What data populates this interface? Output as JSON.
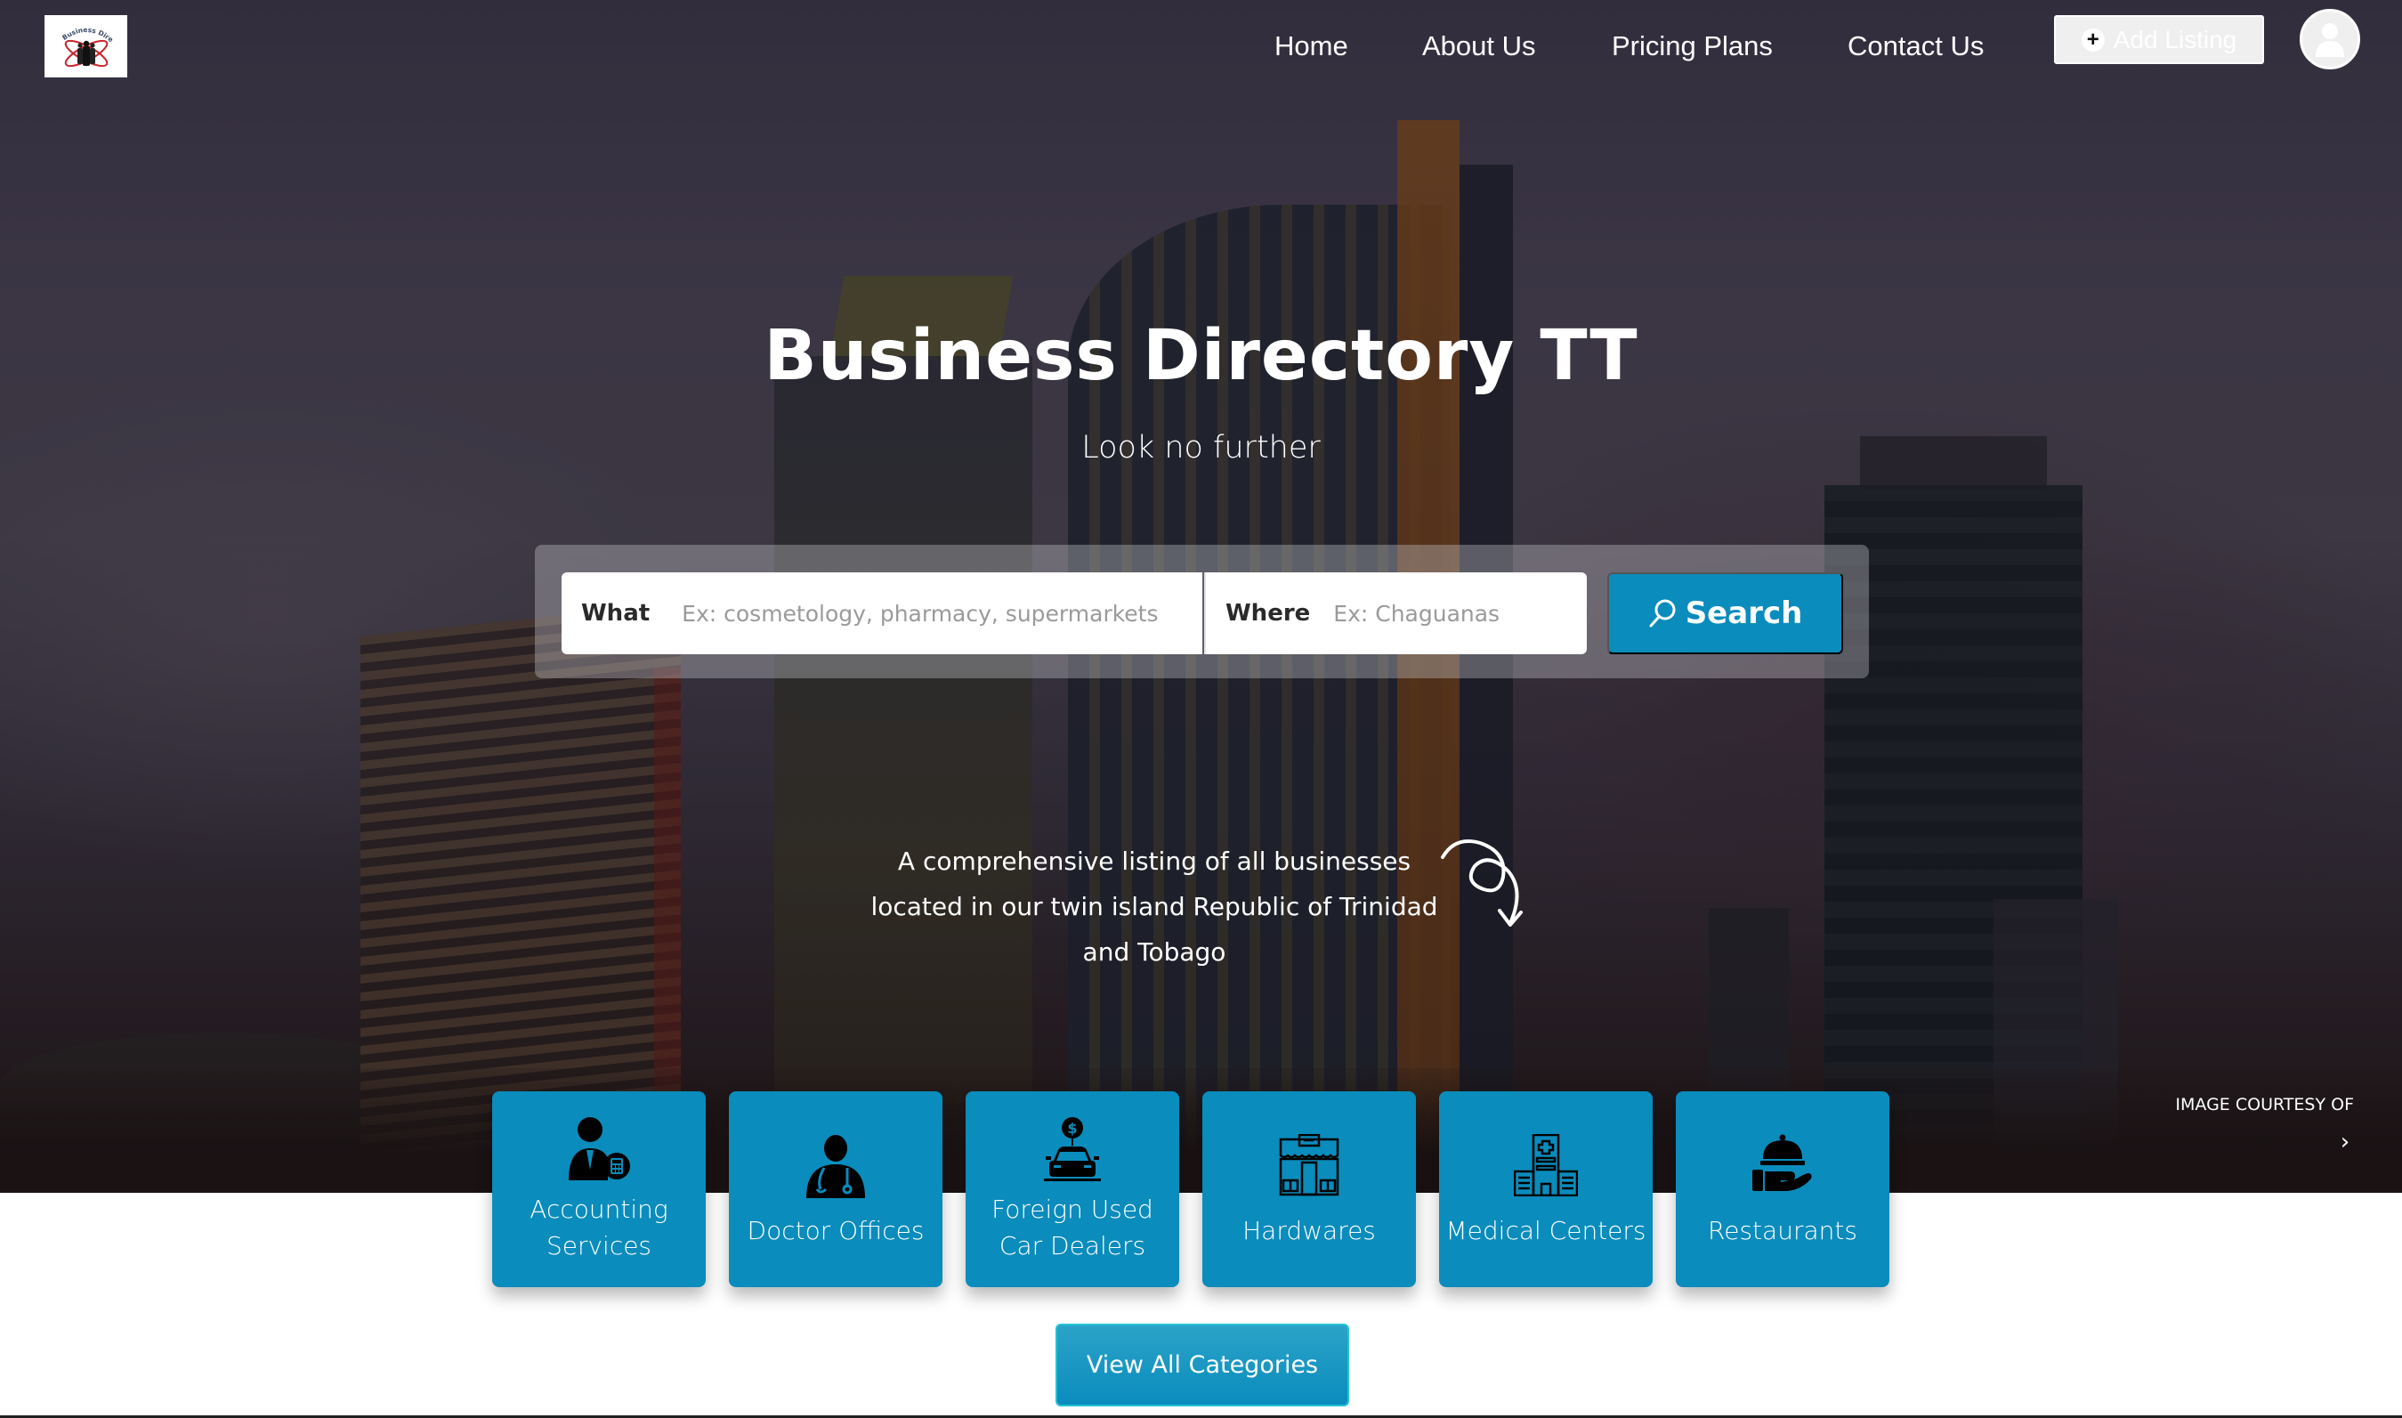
{
  "header": {
    "logo_alt": "Business Directory TT",
    "logo_text": "Business Directory TT",
    "nav": [
      {
        "label": "Home"
      },
      {
        "label": "About Us"
      },
      {
        "label": "Pricing Plans"
      },
      {
        "label": "Contact Us"
      }
    ],
    "add_listing_label": "Add Listing",
    "add_listing_icon": "plus-circle-icon",
    "account_icon": "user-icon"
  },
  "hero": {
    "title": "Business Directory TT",
    "subtitle": "Look no further",
    "description_lines": [
      "A comprehensive listing of all businesses",
      "located in our twin island Republic of Trinidad",
      "and Tobago"
    ],
    "image_courtesy_label": "IMAGE COURTESY OF",
    "image_courtesy_next_icon": "chevron-right-icon"
  },
  "search": {
    "what_label": "What",
    "what_placeholder": "Ex: cosmetology, pharmacy, supermarkets",
    "what_value": "",
    "where_label": "Where",
    "where_placeholder": "Ex: Chaguanas",
    "where_value": "",
    "where_icon": "locate-crosshair-icon",
    "button_label": "Search",
    "button_icon": "search-icon"
  },
  "categories": [
    {
      "label_lines": [
        "Accounting",
        "Services"
      ],
      "icon": "accountant-icon"
    },
    {
      "label_lines": [
        "Doctor Offices"
      ],
      "icon": "doctor-icon"
    },
    {
      "label_lines": [
        "Foreign Used",
        "Car Dealers"
      ],
      "icon": "car-dealer-icon"
    },
    {
      "label_lines": [
        "Hardwares"
      ],
      "icon": "hardware-store-icon"
    },
    {
      "label_lines": [
        "Medical Centers"
      ],
      "icon": "hospital-icon"
    },
    {
      "label_lines": [
        "Restaurants"
      ],
      "icon": "restaurant-service-icon"
    }
  ],
  "view_all_label": "View All Categories",
  "colors": {
    "primary": "#0a8cbc",
    "accent_border": "#22c3d4",
    "text_on_dark": "#ffffff"
  }
}
